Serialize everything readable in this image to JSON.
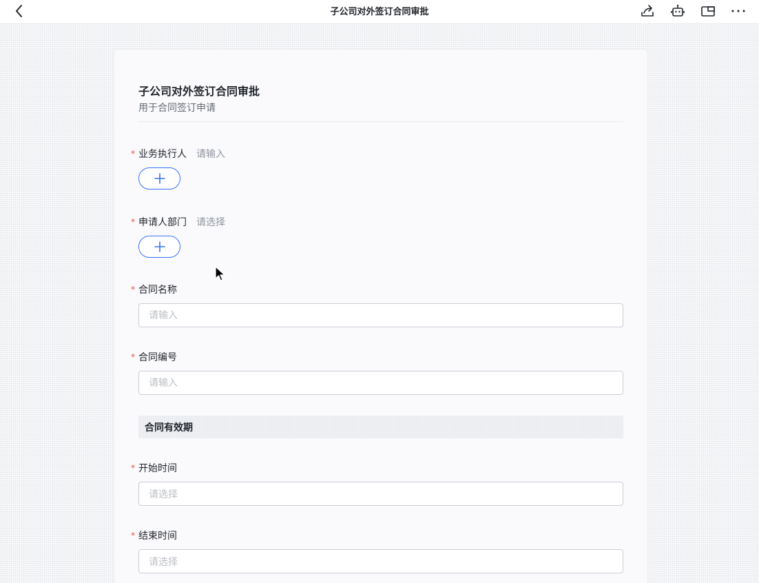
{
  "header": {
    "title": "子公司对外签订合同审批",
    "back_icon": "chevron-left-icon",
    "actions": [
      "share-icon",
      "robot-icon",
      "window-icon",
      "more-icon"
    ]
  },
  "form": {
    "title": "子公司对外签订合同审批",
    "description": "用于合同签订申请",
    "required_mark": "*",
    "accent_color": "#3370ff",
    "required_color": "#f54a45"
  },
  "fields": {
    "executor": {
      "label": "业务执行人",
      "hint": "请输入"
    },
    "department": {
      "label": "申请人部门",
      "hint": "请选择"
    },
    "contract_name": {
      "label": "合同名称",
      "placeholder": "请输入"
    },
    "contract_number": {
      "label": "合同编号",
      "placeholder": "请输入"
    },
    "start_time": {
      "label": "开始时间",
      "placeholder": "请选择"
    },
    "end_time": {
      "label": "结束时间",
      "placeholder": "请选择"
    }
  },
  "sections": {
    "validity": "合同有效期"
  }
}
